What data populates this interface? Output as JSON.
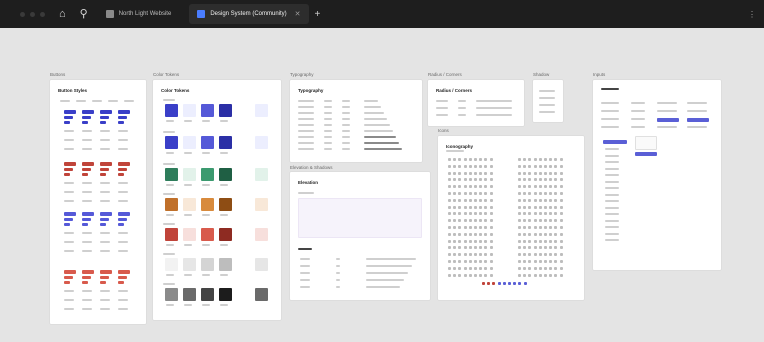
{
  "titlebar": {
    "home_icon": "home-icon",
    "search_icon": "search-icon",
    "tabs": [
      {
        "label": "North Light Website",
        "active": false
      },
      {
        "label": "Design System (Community)",
        "active": true
      }
    ],
    "plus_icon": "plus-icon"
  },
  "frames": {
    "buttons": {
      "label": "Buttons",
      "title": "Button Styles"
    },
    "colors": {
      "label": "Color Tokens",
      "title": "Color Tokens"
    },
    "typography": {
      "label": "Typography",
      "title": "Typography"
    },
    "radius": {
      "label": "Radius / Corners",
      "title": "Radius / Corners"
    },
    "shadow": {
      "label": "Shadow"
    },
    "inputs": {
      "label": "Inputs"
    },
    "elevation": {
      "label": "Elevation & Shadows",
      "title": "Elevation"
    },
    "icons": {
      "label": "Icons",
      "title": "Iconography"
    }
  },
  "colors": {
    "accent": "#5a5fd6",
    "blue": [
      "#3a3fc8",
      "#eceefe",
      "#5559d8",
      "#2b2fa6"
    ],
    "green": [
      "#2e7d5b",
      "#e2f2ea",
      "#3b9a6f",
      "#1f5f44"
    ],
    "orange": [
      "#c0702a",
      "#f8e8d8",
      "#d88a3c",
      "#8e4d14"
    ],
    "red": [
      "#c0443a",
      "#f7dfdc",
      "#d85a4c",
      "#8e2b22"
    ],
    "neutral": [
      "#f2f2f2",
      "#e6e6e6",
      "#d4d4d4",
      "#bdbdbd"
    ],
    "dark": [
      "#8a8a8a",
      "#6a6a6a",
      "#444444",
      "#1c1c1c"
    ]
  }
}
